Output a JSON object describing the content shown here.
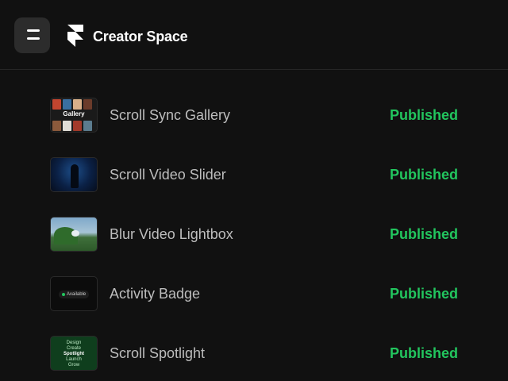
{
  "header": {
    "menu_icon": "menu-icon",
    "logo_icon": "framer-logo-icon",
    "brand": "Creator Space"
  },
  "items": [
    {
      "title": "Scroll Sync Gallery",
      "status": "Published",
      "thumb": {
        "icon": "gallery-thumbnail",
        "label": "Gallery"
      }
    },
    {
      "title": "Scroll Video Slider",
      "status": "Published",
      "thumb": {
        "icon": "video-slider-thumbnail"
      }
    },
    {
      "title": "Blur Video Lightbox",
      "status": "Published",
      "thumb": {
        "icon": "lightbox-thumbnail"
      }
    },
    {
      "title": "Activity Badge",
      "status": "Published",
      "thumb": {
        "icon": "activity-badge-thumbnail",
        "label": "Available"
      }
    },
    {
      "title": "Scroll Spotlight",
      "status": "Published",
      "thumb": {
        "icon": "spotlight-thumbnail",
        "lines": [
          "Design",
          "Create",
          "Spotlight",
          "Launch",
          "Grow"
        ]
      }
    }
  ],
  "colors": {
    "background": "#111111",
    "status": "#22c55e",
    "title": "#bdbdbd",
    "brand": "#ffffff"
  }
}
